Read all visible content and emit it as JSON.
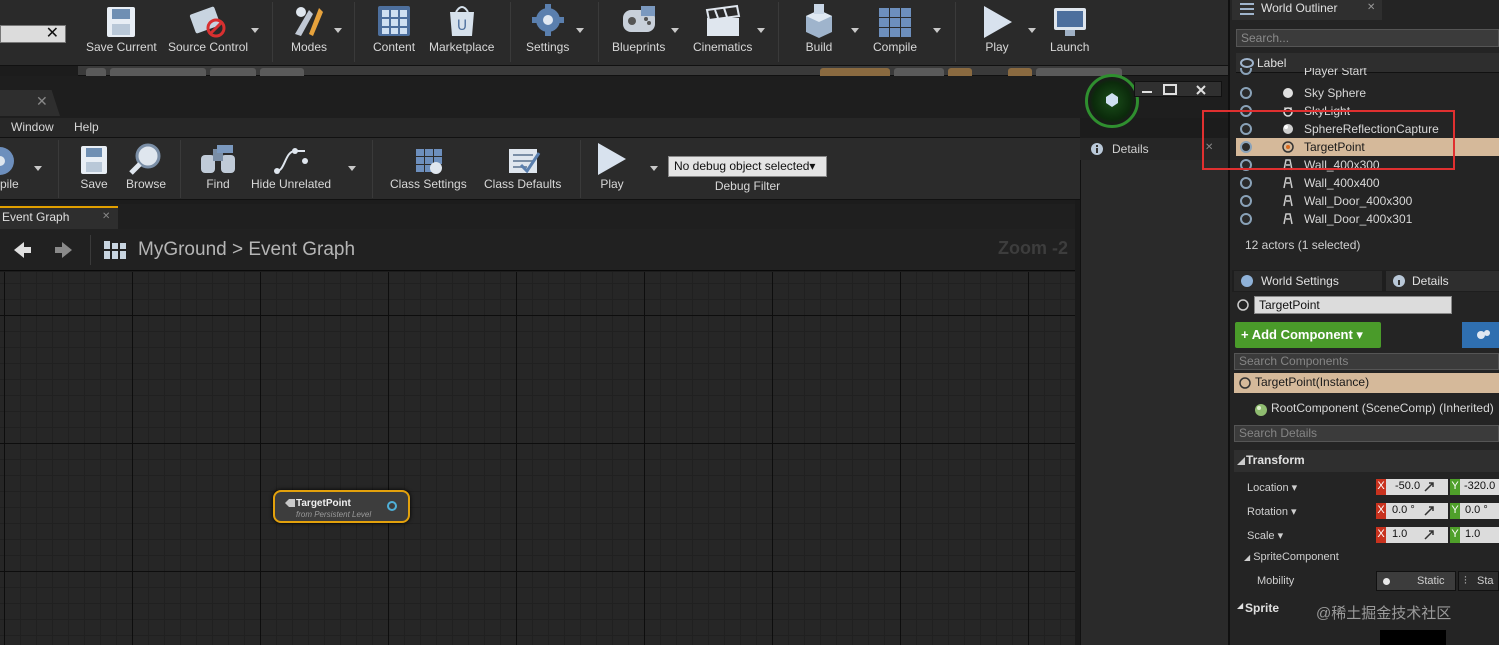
{
  "main_toolbar": {
    "search_close": "✕",
    "buttons": [
      {
        "label": "Save Current",
        "icon": "floppy-icon"
      },
      {
        "label": "Source Control",
        "icon": "source-control-icon"
      },
      {
        "label": "Modes",
        "icon": "modes-icon"
      },
      {
        "label": "Content",
        "icon": "content-icon"
      },
      {
        "label": "Marketplace",
        "icon": "marketplace-icon"
      },
      {
        "label": "Settings",
        "icon": "settings-icon"
      },
      {
        "label": "Blueprints",
        "icon": "blueprints-icon"
      },
      {
        "label": "Cinematics",
        "icon": "cinematics-icon"
      },
      {
        "label": "Build",
        "icon": "build-icon"
      },
      {
        "label": "Compile",
        "icon": "compile-icon"
      },
      {
        "label": "Play",
        "icon": "play-icon"
      },
      {
        "label": "Launch",
        "icon": "launch-icon"
      }
    ]
  },
  "blueprint_editor": {
    "tab_close": "✕",
    "menu": [
      "Window",
      "Help"
    ],
    "toolbar": {
      "compile": "pile",
      "save": "Save",
      "browse": "Browse",
      "find": "Find",
      "hide_unrelated": "Hide Unrelated",
      "class_settings": "Class Settings",
      "class_defaults": "Class Defaults",
      "play": "Play",
      "debug_select": "No debug object selected▾",
      "debug_filter": "Debug Filter"
    },
    "graph_tab": "Event Graph",
    "breadcrumb": {
      "root": "MyGround",
      "sep": ">",
      "leaf": "Event Graph"
    },
    "zoom": "Zoom -2",
    "details_label": "Details",
    "node": {
      "title": "TargetPoint",
      "subtitle": "from Persistent Level"
    }
  },
  "world_outliner": {
    "tab": "World Outliner",
    "tab_close": "✕",
    "search_placeholder": "Search...",
    "column_label": "Label",
    "actors": [
      {
        "name": "Player Start",
        "icon": "player-start-icon",
        "selected": false
      },
      {
        "name": "Sky Sphere",
        "icon": "sphere-icon",
        "selected": false
      },
      {
        "name": "SkyLight",
        "icon": "skylight-icon",
        "selected": false
      },
      {
        "name": "SphereReflectionCapture",
        "icon": "reflection-capture-icon",
        "selected": false
      },
      {
        "name": "TargetPoint",
        "icon": "target-point-icon",
        "selected": true
      },
      {
        "name": "Wall_400x300",
        "icon": "mesh-icon",
        "selected": false
      },
      {
        "name": "Wall_400x400",
        "icon": "mesh-icon",
        "selected": false
      },
      {
        "name": "Wall_Door_400x300",
        "icon": "mesh-icon",
        "selected": false
      },
      {
        "name": "Wall_Door_400x301",
        "icon": "mesh-icon",
        "selected": false
      }
    ],
    "count": "12 actors (1 selected)"
  },
  "details_panel": {
    "tabs": [
      "World Settings",
      "Details"
    ],
    "tab_close": "✕",
    "actor_name": "TargetPoint",
    "add_component": "+ Add Component ▾",
    "search_components": "Search Components",
    "instance": "TargetPoint(Instance)",
    "root_component": "RootComponent (SceneComp) (Inherited)",
    "search_details": "Search Details",
    "transform_header": "Transform",
    "location_label": "Location ▾",
    "rotation_label": "Rotation ▾",
    "scale_label": "Scale ▾",
    "location": {
      "x": "-50.0",
      "y": "-320.0"
    },
    "rotation": {
      "x": "0.0 °",
      "y": "0.0 °"
    },
    "scale": {
      "x": "1.0",
      "y": "1.0"
    },
    "axis_x": "X",
    "axis_y": "Y",
    "sprite_component": "SpriteComponent",
    "mobility_label": "Mobility",
    "mobility_static": "Static",
    "mobility_stationary": "Sta",
    "sprite_header": "Sprite"
  },
  "watermark": "@稀土掘金技术社区",
  "colors": {
    "accent_green": "#4a9b2a",
    "selection": "#d5b99a",
    "highlight_box": "#e03030",
    "node_border": "#e3a10c"
  }
}
